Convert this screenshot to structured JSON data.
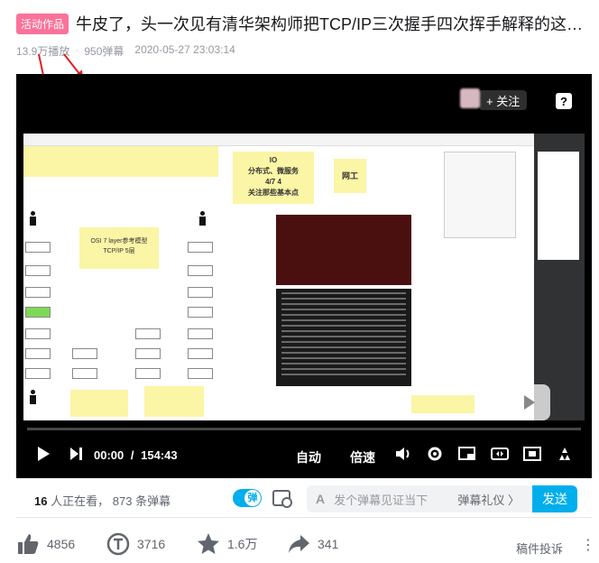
{
  "header": {
    "badge": "活动作品",
    "title": "牛皮了，头一次见有清华架构师把TCP/IP三次握手四次挥手解释的这…",
    "views": "13.9万播放",
    "separator": "·",
    "danmaku_count": "950弹幕",
    "datetime": "2020-05-27 23:03:14"
  },
  "player": {
    "follow_label": "+ 关注",
    "help_label": "?",
    "slide_text": {
      "io_box": [
        "IO",
        "分布式、微服务",
        "4/7   4",
        "关注那些基本点"
      ],
      "worker": "网工",
      "osi_note": [
        "OSI 7 layer参考模型",
        "TCP/IP  5层"
      ]
    },
    "time_current": "00:00",
    "time_sep": "/",
    "time_total": "154:43",
    "auto_label": "自动",
    "speed_label": "倍速",
    "progress": 0
  },
  "danmaku_bar": {
    "watching_count": "16",
    "watching_text": "人正在看，",
    "danmaku_count": "873",
    "danmaku_text": "条弹幕",
    "toggle_label": "弹",
    "input_icon": "A",
    "input_placeholder": "发个弹幕见证当下",
    "etiquette_label": "弹幕礼仪 〉",
    "send_label": "发送"
  },
  "actions": {
    "like": "4856",
    "coin": "3716",
    "favorite": "1.6万",
    "share": "341",
    "report_label": "稿件投诉",
    "more_label": "⋮"
  },
  "colors": {
    "brand_pink": "#fb7299",
    "brand_blue": "#00aeec",
    "annotation_red": "#e02020"
  }
}
